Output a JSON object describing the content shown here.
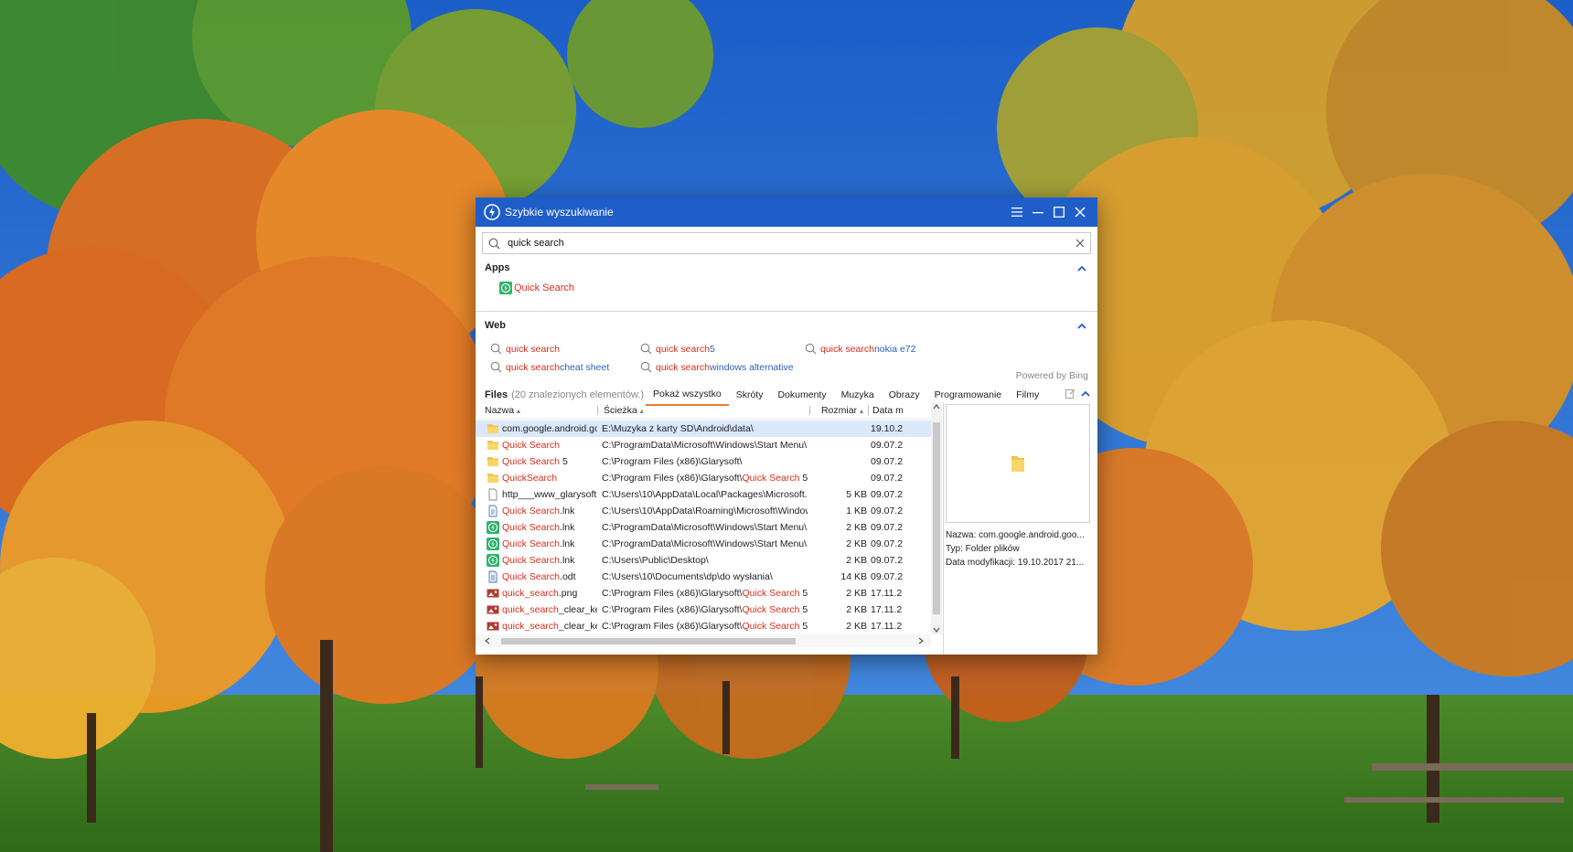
{
  "window": {
    "title": "Szybkie wyszukiwanie"
  },
  "search": {
    "value": "quick search"
  },
  "apps": {
    "title": "Apps",
    "items": [
      {
        "label": "Quick Search"
      }
    ]
  },
  "web": {
    "title": "Web",
    "suggestions": [
      {
        "main": "quick search",
        "extra": ""
      },
      {
        "main": "quick search",
        "extra": " 5"
      },
      {
        "main": "quick search",
        "extra": " nokia e72"
      },
      {
        "main": "quick search",
        "extra": " cheat sheet"
      },
      {
        "main": "quick search",
        "extra": " windows alternative"
      }
    ],
    "powered": "Powered by Bing"
  },
  "files": {
    "label": "Files",
    "count": "(20 znalezionych elementów.)",
    "tabs": [
      "Pokaż wszystko",
      "Skróty",
      "Dokumenty",
      "Muzyka",
      "Obrazy",
      "Programowanie",
      "Filmy"
    ],
    "columns": {
      "name": "Nazwa",
      "path": "Ścieżka",
      "size": "Rozmiar",
      "date": "Data m"
    },
    "rows": [
      {
        "icon": "folder-icon",
        "name": "com.google.android.go...",
        "name_red": "",
        "name_rest": "",
        "path_pre": "E:\\Muzyka z karty SD\\Android\\data\\",
        "path_red": "",
        "path_post": "",
        "size": "",
        "date": "19.10.2"
      },
      {
        "icon": "folder-icon",
        "name": "",
        "name_red": "Quick Search",
        "name_rest": "",
        "path_pre": "C:\\ProgramData\\Microsoft\\Windows\\Start Menu\\Pr...",
        "path_red": "",
        "path_post": "",
        "size": "",
        "date": "09.07.2"
      },
      {
        "icon": "folder-icon",
        "name": "",
        "name_red": "Quick Search",
        "name_rest": " 5",
        "path_pre": "C:\\Program Files (x86)\\Glarysoft\\",
        "path_red": "",
        "path_post": "",
        "size": "",
        "date": "09.07.2"
      },
      {
        "icon": "folder-icon",
        "name": "",
        "name_red": "QuickSearch",
        "name_rest": "",
        "path_pre": "C:\\Program Files (x86)\\Glarysoft\\",
        "path_red": "Quick Search",
        "path_post": " 5\\Re...",
        "size": "",
        "date": "09.07.2"
      },
      {
        "icon": "file-icon",
        "name": "http___www_glarysoft...",
        "name_red": "",
        "name_rest": "",
        "path_pre": "C:\\Users\\10\\AppData\\Local\\Packages\\Microsoft.Wi...",
        "path_red": "",
        "path_post": "",
        "size": "5 KB",
        "date": "09.07.2"
      },
      {
        "icon": "shortcut-icon",
        "name": "",
        "name_red": "Quick Search",
        "name_rest": ".lnk",
        "path_pre": "C:\\Users\\10\\AppData\\Roaming\\Microsoft\\Windows\\...",
        "path_red": "",
        "path_post": "",
        "size": "1 KB",
        "date": "09.07.2"
      },
      {
        "icon": "app-shortcut-icon",
        "name": "",
        "name_red": "Quick Search",
        "name_rest": ".lnk",
        "path_pre": "C:\\ProgramData\\Microsoft\\Windows\\Start Menu\\Pr...",
        "path_red": "",
        "path_post": "",
        "size": "2 KB",
        "date": "09.07.2"
      },
      {
        "icon": "app-shortcut-icon",
        "name": "",
        "name_red": "Quick Search",
        "name_rest": ".lnk",
        "path_pre": "C:\\ProgramData\\Microsoft\\Windows\\Start Menu\\Pr...",
        "path_red": "",
        "path_post": "",
        "size": "2 KB",
        "date": "09.07.2"
      },
      {
        "icon": "app-shortcut-icon",
        "name": "",
        "name_red": "Quick Search",
        "name_rest": ".lnk",
        "path_pre": "C:\\Users\\Public\\Desktop\\",
        "path_red": "",
        "path_post": "",
        "size": "2 KB",
        "date": "09.07.2"
      },
      {
        "icon": "document-icon",
        "name": "",
        "name_red": "Quick Search",
        "name_rest": ".odt",
        "path_pre": "C:\\Users\\10\\Documents\\dp\\do wysłania\\",
        "path_red": "",
        "path_post": "",
        "size": "14 KB",
        "date": "09.07.2"
      },
      {
        "icon": "image-icon",
        "name": "",
        "name_red": "quick_search",
        "name_rest": ".png",
        "path_pre": "C:\\Program Files (x86)\\Glarysoft\\",
        "path_red": "Quick Search",
        "path_post": " 5\\Re...",
        "size": "2 KB",
        "date": "17.11.2"
      },
      {
        "icon": "image-icon",
        "name": "",
        "name_red": "quick_search",
        "name_rest": "_clear_ke...",
        "path_pre": "C:\\Program Files (x86)\\Glarysoft\\",
        "path_red": "Quick Search",
        "path_post": " 5\\Re...",
        "size": "2 KB",
        "date": "17.11.2"
      },
      {
        "icon": "image-icon",
        "name": "",
        "name_red": "quick_search",
        "name_rest": "_clear_ke...",
        "path_pre": "C:\\Program Files (x86)\\Glarysoft\\",
        "path_red": "Quick Search",
        "path_post": " 5\\Re...",
        "size": "2 KB",
        "date": "17.11.2"
      }
    ]
  },
  "preview": {
    "name": "Nazwa: com.google.android.goo...",
    "type": "Typ: Folder plików",
    "modified": "Data modyfikacji: 19.10.2017 21..."
  },
  "colors": {
    "titlebar": "#1f5dc9",
    "highlight": "#d62e1e",
    "accent": "#ea7a2d",
    "selected_row": "#dbe7fb"
  }
}
